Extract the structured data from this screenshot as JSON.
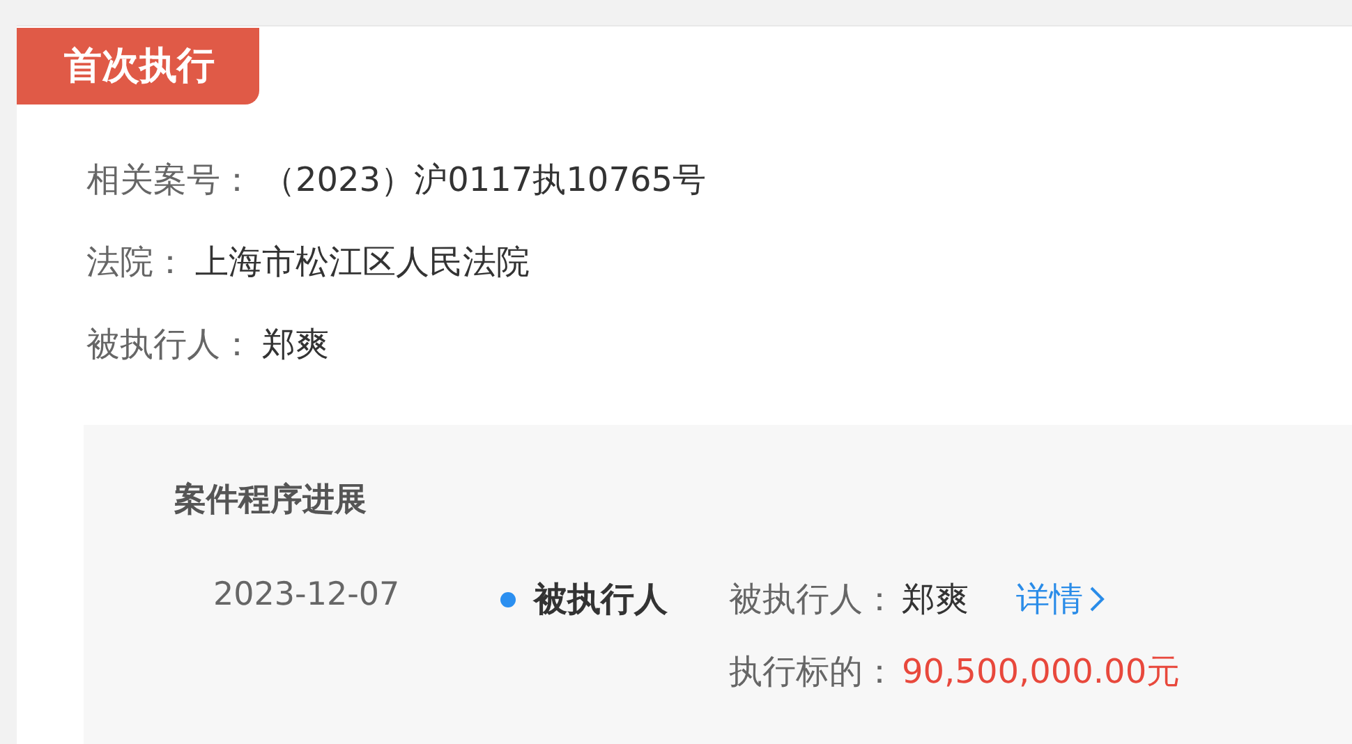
{
  "section_tag": "首次执行",
  "fields": [
    {
      "label": "相关案号：",
      "value": "（2023）沪0117执10765号"
    },
    {
      "label": "法院：",
      "value": "上海市松江区人民法院"
    },
    {
      "label": "被执行人：",
      "value": "郑爽"
    }
  ],
  "progress": {
    "title": "案件程序进展",
    "entries": [
      {
        "date": "2023-12-07",
        "type": "被执行人",
        "details": [
          {
            "label": "被执行人：",
            "value": "郑爽",
            "kind": "plain"
          },
          {
            "label": "执行标的：",
            "value": "90,500,000.00元",
            "kind": "amount"
          }
        ],
        "link": "详情"
      }
    ]
  }
}
